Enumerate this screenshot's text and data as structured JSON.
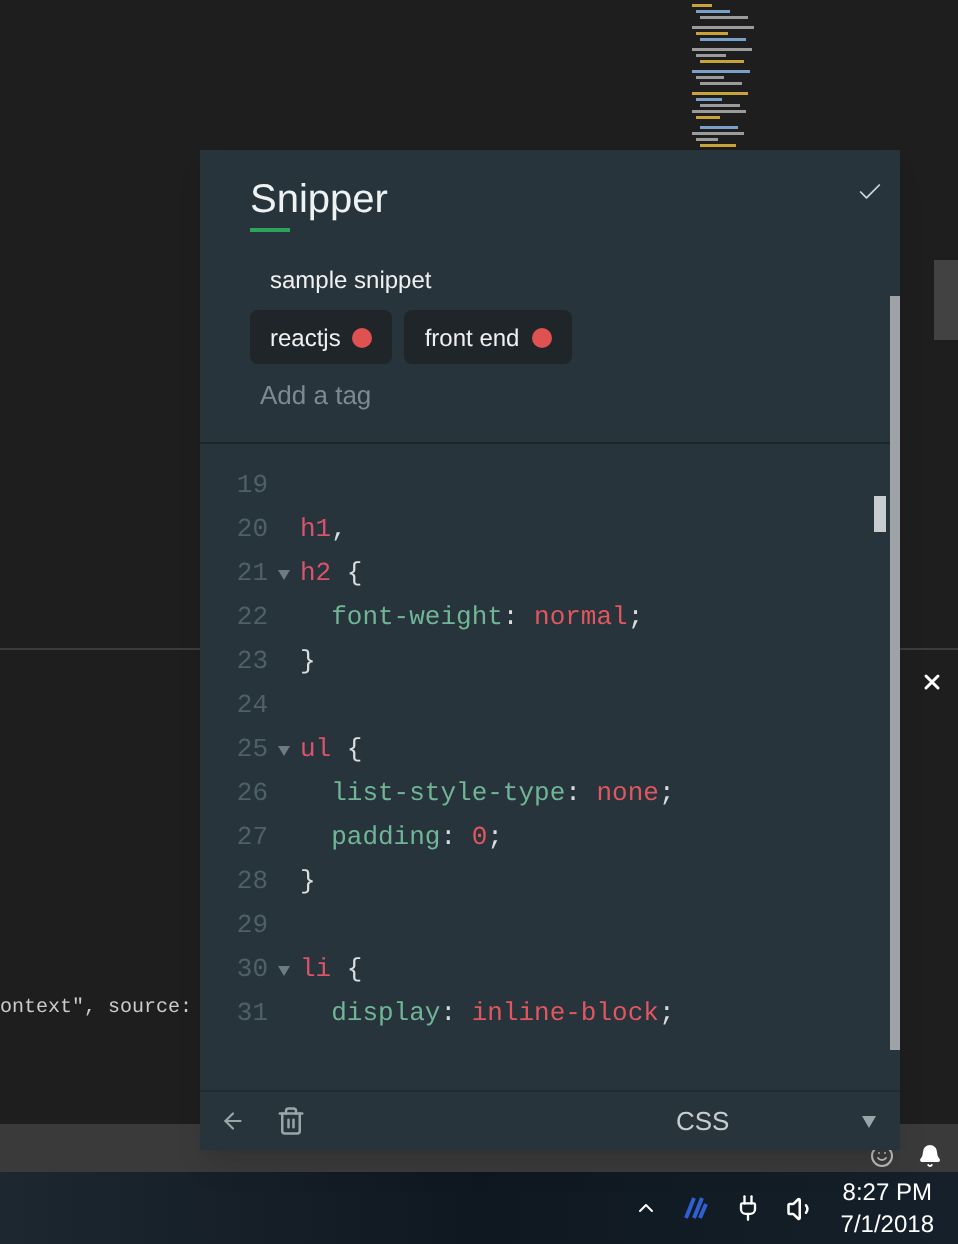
{
  "editor": {
    "console_text": "ontext\", source:"
  },
  "snipper": {
    "title": "Snipper",
    "snippet_name": "sample snippet",
    "tags": [
      {
        "label": "reactjs",
        "color": "#e05252"
      },
      {
        "label": "front end",
        "color": "#e05252"
      }
    ],
    "tag_placeholder": "Add a tag",
    "code": [
      {
        "number": "19",
        "fold": false
      },
      {
        "number": "20",
        "fold": false,
        "tokens": [
          {
            "kind": "selector",
            "text": "h1"
          },
          {
            "kind": "punct",
            "text": ","
          }
        ]
      },
      {
        "number": "21",
        "fold": true,
        "tokens": [
          {
            "kind": "selector",
            "text": "h2"
          },
          {
            "kind": "punct",
            "text": " {"
          }
        ]
      },
      {
        "number": "22",
        "fold": false,
        "tokens": [
          {
            "kind": "property",
            "text": "  font-weight"
          },
          {
            "kind": "punct",
            "text": ": "
          },
          {
            "kind": "value",
            "text": "normal"
          },
          {
            "kind": "punct",
            "text": ";"
          }
        ]
      },
      {
        "number": "23",
        "fold": false,
        "tokens": [
          {
            "kind": "punct",
            "text": "}"
          }
        ]
      },
      {
        "number": "24",
        "fold": false
      },
      {
        "number": "25",
        "fold": true,
        "tokens": [
          {
            "kind": "selector",
            "text": "ul"
          },
          {
            "kind": "punct",
            "text": " {"
          }
        ]
      },
      {
        "number": "26",
        "fold": false,
        "tokens": [
          {
            "kind": "property",
            "text": "  list-style-type"
          },
          {
            "kind": "punct",
            "text": ": "
          },
          {
            "kind": "value",
            "text": "none"
          },
          {
            "kind": "punct",
            "text": ";"
          }
        ]
      },
      {
        "number": "27",
        "fold": false,
        "tokens": [
          {
            "kind": "property",
            "text": "  padding"
          },
          {
            "kind": "punct",
            "text": ": "
          },
          {
            "kind": "value",
            "text": "0"
          },
          {
            "kind": "punct",
            "text": ";"
          }
        ]
      },
      {
        "number": "28",
        "fold": false,
        "tokens": [
          {
            "kind": "punct",
            "text": "}"
          }
        ]
      },
      {
        "number": "29",
        "fold": false
      },
      {
        "number": "30",
        "fold": true,
        "tokens": [
          {
            "kind": "selector",
            "text": "li"
          },
          {
            "kind": "punct",
            "text": " {"
          }
        ]
      },
      {
        "number": "31",
        "fold": false,
        "tokens": [
          {
            "kind": "property",
            "text": "  display"
          },
          {
            "kind": "punct",
            "text": ": "
          },
          {
            "kind": "value",
            "text": "inline-block"
          },
          {
            "kind": "punct",
            "text": ";"
          }
        ]
      }
    ],
    "language": "CSS"
  },
  "taskbar": {
    "time": "8:27 PM",
    "date": "7/1/2018"
  }
}
